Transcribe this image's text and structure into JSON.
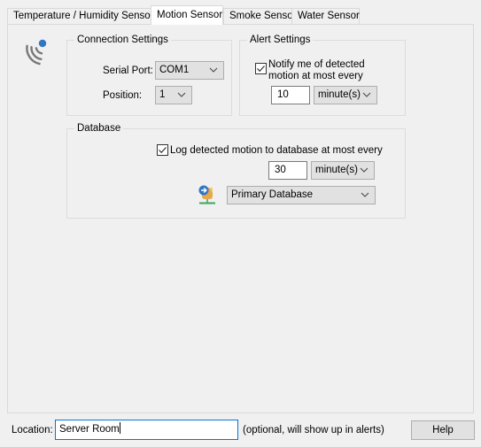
{
  "tabs": [
    {
      "label": "Temperature / Humidity Sensor",
      "active": false
    },
    {
      "label": "Motion Sensor",
      "active": true
    },
    {
      "label": "Smoke Sensor",
      "active": false
    },
    {
      "label": "Water Sensor",
      "active": false
    }
  ],
  "panel_icon": "motion-sensor-icon",
  "connection_settings": {
    "title": "Connection Settings",
    "serial_port_label": "Serial Port:",
    "serial_port_value": "COM1",
    "position_label": "Position:",
    "position_value": "1"
  },
  "alert_settings": {
    "title": "Alert Settings",
    "notify_checked": true,
    "notify_label_line1": "Notify me of detected",
    "notify_label_line2": "motion at most every",
    "interval_value": "10",
    "interval_unit": "minute(s)"
  },
  "database": {
    "title": "Database",
    "log_checked": true,
    "log_label": "Log detected motion to database at most every",
    "interval_value": "30",
    "interval_unit": "minute(s)",
    "database_icon": "database-connection-icon",
    "database_value": "Primary Database"
  },
  "footer": {
    "location_label": "Location:",
    "location_value": "Server Room",
    "location_hint": "(optional, will show up in alerts)",
    "help_label": "Help"
  },
  "colors": {
    "accent_blue": "#0078d7",
    "icon_blue": "#2f77c4",
    "icon_orange": "#e8a94c",
    "icon_green": "#3aa85a"
  }
}
